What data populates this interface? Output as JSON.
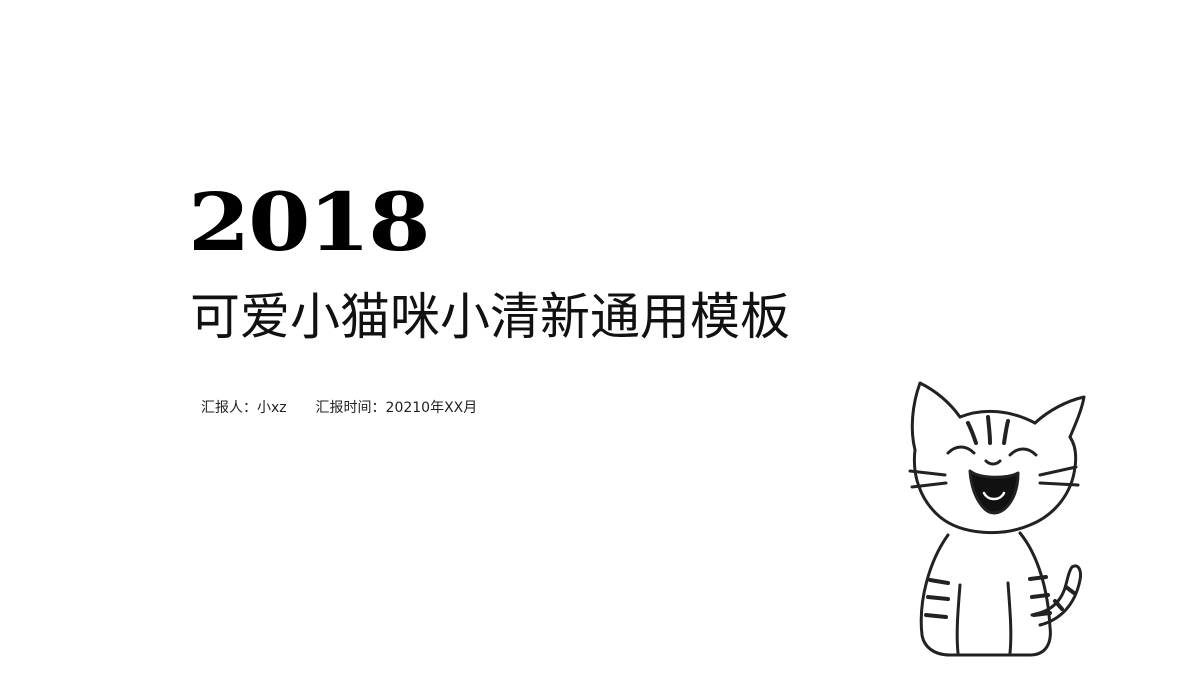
{
  "slide": {
    "year": "2018",
    "title": "可爱小猫咪小清新通用模板",
    "reporter": "汇报人：小xz",
    "report_time": "汇报时间：20210年XX月"
  },
  "illustration": {
    "icon": "laughing-cat-icon"
  },
  "colors": {
    "background": "#ffffff",
    "text": "#111111"
  }
}
